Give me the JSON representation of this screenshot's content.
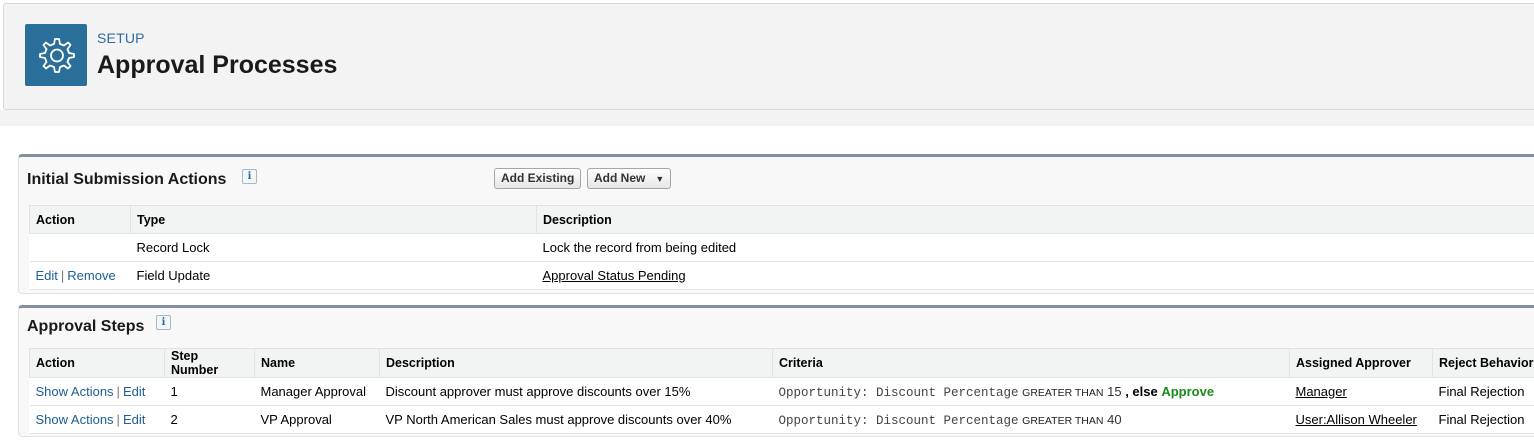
{
  "header": {
    "icon": "gear-icon",
    "overline": "SETUP",
    "title": "Approval Processes"
  },
  "initial_submission": {
    "title": "Initial Submission Actions",
    "buttons": {
      "add_existing": "Add Existing",
      "add_new": "Add New"
    },
    "columns": [
      "Action",
      "Type",
      "Description"
    ],
    "rows": [
      {
        "actions": [],
        "type": "Record Lock",
        "description": "Lock the record from being edited"
      },
      {
        "actions": [
          "Edit",
          "Remove"
        ],
        "type": "Field Update",
        "description": "Approval Status Pending"
      }
    ]
  },
  "approval_steps": {
    "title": "Approval Steps",
    "columns": [
      "Action",
      "Step Number",
      "Name",
      "Description",
      "Criteria",
      "Assigned Approver",
      "Reject Behavior"
    ],
    "rows": [
      {
        "actions": [
          "Show Actions",
          "Edit"
        ],
        "step": "1",
        "name": "Manager Approval",
        "description": "Discount approver must approve discounts over 15%",
        "criteria_field": "Opportunity: Discount Percentage",
        "criteria_op": "GREATER THAN",
        "criteria_value": "15",
        "criteria_else": ", else",
        "criteria_else_action": "Approve",
        "approver": "Manager",
        "reject": "Final Rejection"
      },
      {
        "actions": [
          "Show Actions",
          "Edit"
        ],
        "step": "2",
        "name": "VP Approval",
        "description": "VP North American Sales must approve discounts over 40%",
        "criteria_field": "Opportunity: Discount Percentage",
        "criteria_op": "GREATER THAN",
        "criteria_value": "40",
        "approver": "User:Allison Wheeler",
        "reject": "Final Rejection"
      }
    ]
  },
  "colors": {
    "accent": "#2a6f9a",
    "link": "#1f5d96",
    "approve": "#1b8a1b"
  }
}
